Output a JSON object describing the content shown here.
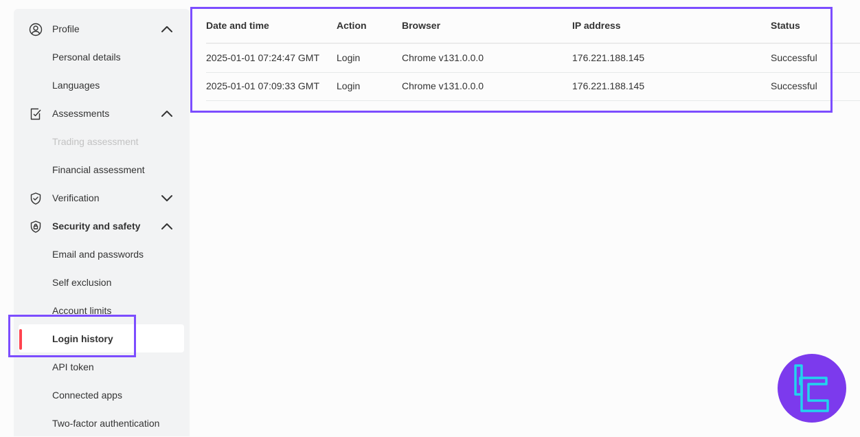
{
  "sidebar": {
    "profile": "Profile",
    "personal_details": "Personal details",
    "languages": "Languages",
    "assessments": "Assessments",
    "trading_assessment": "Trading assessment",
    "financial_assessment": "Financial assessment",
    "verification": "Verification",
    "security_and_safety": "Security and safety",
    "email_and_passwords": "Email and passwords",
    "self_exclusion": "Self exclusion",
    "account_limits": "Account limits",
    "login_history": "Login history",
    "api_token": "API token",
    "connected_apps": "Connected apps",
    "two_factor_authentication": "Two-factor authentication"
  },
  "table": {
    "headers": {
      "date": "Date and time",
      "action": "Action",
      "browser": "Browser",
      "ip": "IP address",
      "status": "Status"
    },
    "rows": [
      {
        "date": "2025-01-01 07:24:47 GMT",
        "action": "Login",
        "browser": "Chrome v131.0.0.0",
        "ip": "176.221.188.145",
        "status": "Successful"
      },
      {
        "date": "2025-01-01 07:09:33 GMT",
        "action": "Login",
        "browser": "Chrome v131.0.0.0",
        "ip": "176.221.188.145",
        "status": "Successful"
      }
    ]
  },
  "colors": {
    "accent": "#ff444f",
    "highlight": "#7c4dff",
    "sidebar_bg": "#f2f3f4",
    "logo_bg": "#7c3aed",
    "logo_stroke": "#22d3ee"
  },
  "icons": {
    "profile": "user-circle-icon",
    "assessments": "clipboard-check-icon",
    "verification": "shield-check-icon",
    "security": "shield-lock-icon",
    "chevron_up": "chevron-up-icon",
    "chevron_down": "chevron-down-icon",
    "logo": "brand-logo-icon"
  }
}
